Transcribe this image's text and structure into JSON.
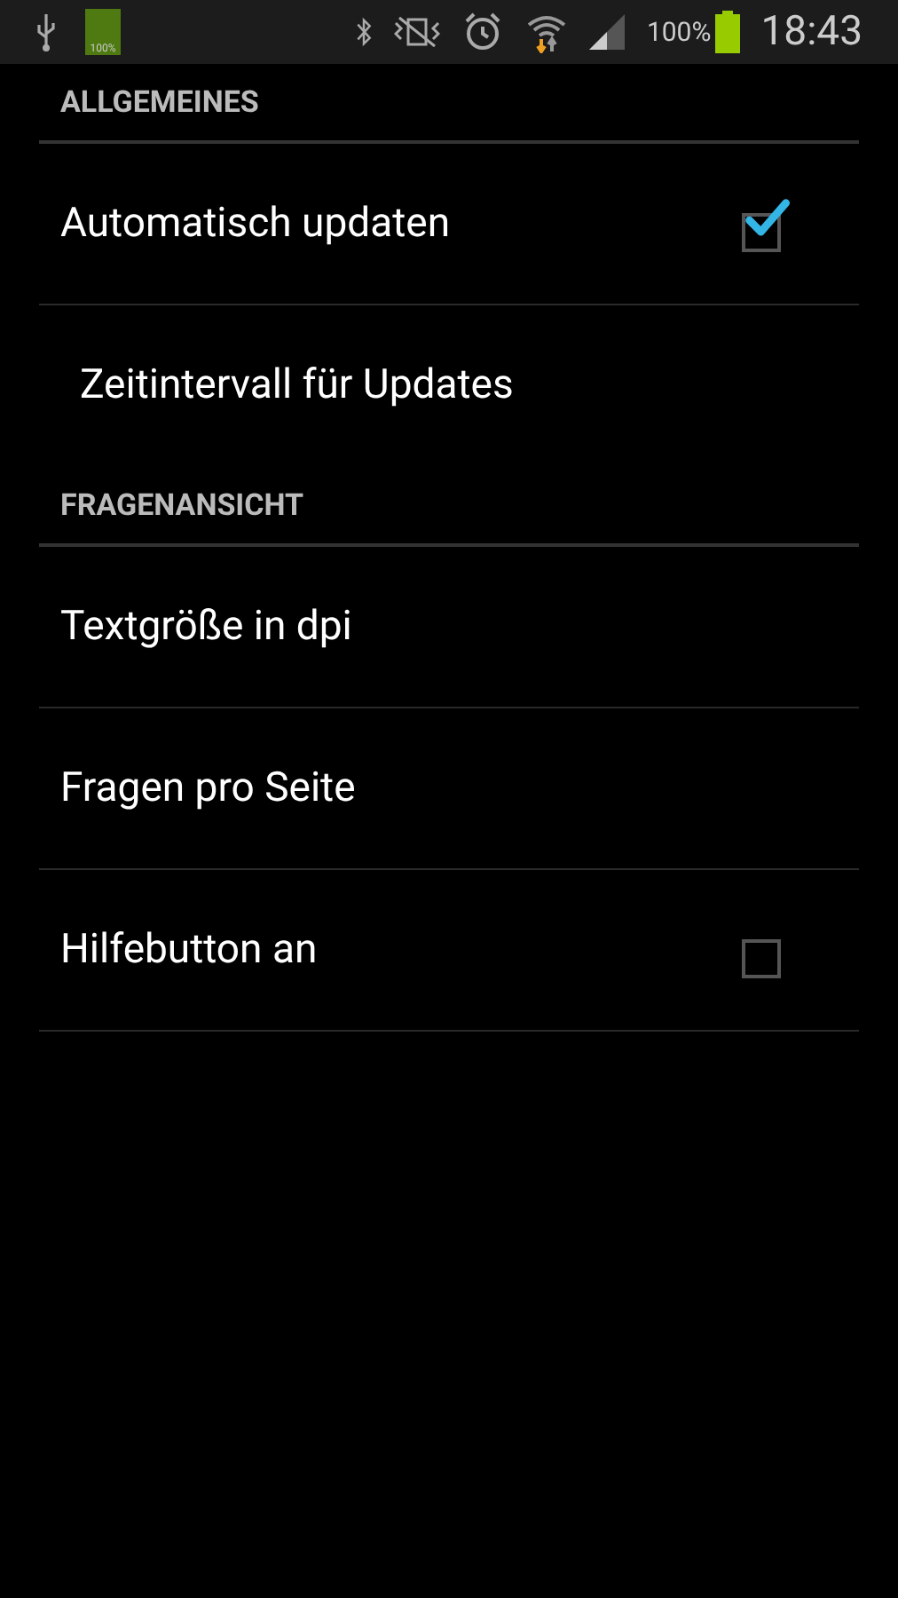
{
  "status_bar": {
    "notification_battery_label": "100%",
    "battery_percent": "100%",
    "time": "18:43"
  },
  "sections": [
    {
      "title": "ALLGEMEINES",
      "items": [
        {
          "kind": "checkbox",
          "label": "Automatisch updaten",
          "checked": true,
          "children": [
            {
              "label": "Zeitintervall für Updates"
            }
          ]
        }
      ]
    },
    {
      "title": "FRAGENANSICHT",
      "items": [
        {
          "kind": "text",
          "label": "Textgröße in dpi"
        },
        {
          "kind": "text",
          "label": "Fragen pro Seite"
        },
        {
          "kind": "checkbox",
          "label": "Hilfebutton an",
          "checked": false
        }
      ]
    }
  ]
}
